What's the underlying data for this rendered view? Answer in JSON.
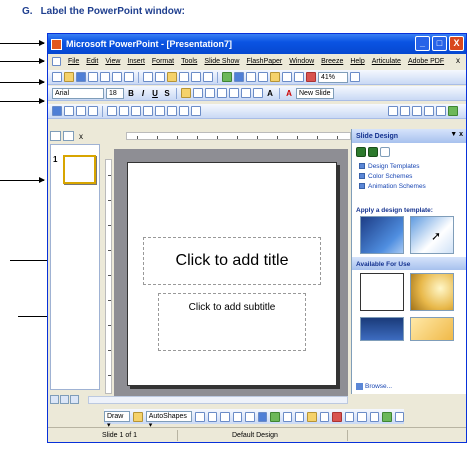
{
  "heading": {
    "letter": "G.",
    "text": "Label the PowerPoint window:"
  },
  "window": {
    "title": "Microsoft PowerPoint - [Presentation7]",
    "controls": [
      "_",
      "□",
      "X"
    ]
  },
  "menu": {
    "items": [
      "File",
      "Edit",
      "View",
      "Insert",
      "Format",
      "Tools",
      "Slide Show",
      "FlashPaper",
      "Window",
      "Breeze",
      "Help",
      "Articulate",
      "Adobe PDF"
    ],
    "close_doc": "x"
  },
  "standard_toolbar": {
    "zoom": "41%"
  },
  "formatting_toolbar": {
    "font": "Arial",
    "size": "18",
    "bold": "B",
    "italic": "I",
    "underline": "U",
    "shadow": "S",
    "grow_font": "A",
    "font_color": "A",
    "new_slide": "New Slide"
  },
  "slides_pane": {
    "slide_number": "1",
    "close": "x"
  },
  "slide": {
    "title_placeholder": "Click to add title",
    "subtitle_placeholder": "Click to add subtitle"
  },
  "task_pane": {
    "title": "Slide Design",
    "controls": "▼ x",
    "links": [
      "Design Templates",
      "Color Schemes",
      "Animation Schemes"
    ],
    "apply_label": "Apply a design template:",
    "available_label": "Available For Use",
    "browse": "Browse..."
  },
  "drawing_toolbar": {
    "draw": "Draw ▾",
    "autoshapes": "AutoShapes ▾"
  },
  "status_bar": {
    "slide_info": "Slide 1 of 1",
    "design": "Default Design"
  }
}
